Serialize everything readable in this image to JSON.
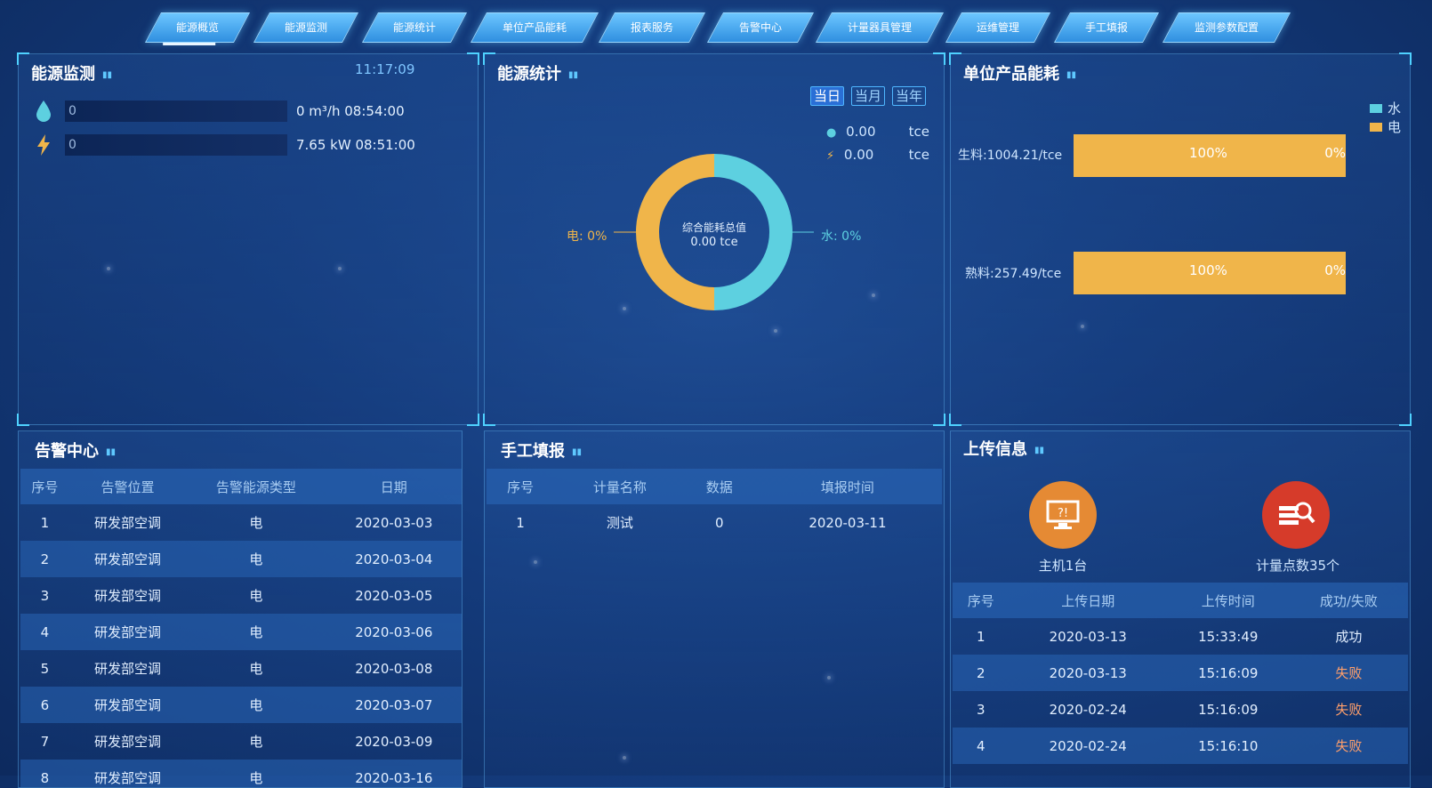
{
  "nav": [
    "能源概览",
    "能源监测",
    "能源统计",
    "单位产品能耗",
    "报表服务",
    "告警中心",
    "计量器具管理",
    "运维管理",
    "手工填报",
    "监测参数配置"
  ],
  "monitor": {
    "title": "能源监测",
    "time": "11:17:09",
    "rows": [
      {
        "icon": "water-drop-icon",
        "bar": "0",
        "text": "0 m³/h  08:54:00"
      },
      {
        "icon": "lightning-icon",
        "bar": "0",
        "text": "7.65 kW  08:51:00"
      }
    ]
  },
  "stats": {
    "title": "能源统计",
    "tabs": [
      "当日",
      "当月",
      "当年"
    ],
    "water_value": "0.00",
    "elec_value": "0.00",
    "unit": "tce",
    "center_label": "综合能耗总值",
    "center_value": "0.00 tce",
    "label_left": "电: 0%",
    "label_right": "水: 0%"
  },
  "chart_data": {
    "type": "pie",
    "categories": [
      "水",
      "电"
    ],
    "values": [
      50,
      50
    ]
  },
  "unit_energy": {
    "title": "单位产品能耗",
    "legend": [
      "水",
      "电"
    ],
    "legend_colors": [
      "#5dd0e0",
      "#f0b54a"
    ],
    "rows": [
      {
        "label": "生料:1004.21/tce",
        "left": "100%",
        "right": "0%"
      },
      {
        "label": "熟料:257.49/tce",
        "left": "100%",
        "right": "0%"
      }
    ]
  },
  "alarm": {
    "title": "告警中心",
    "headers": [
      "序号",
      "告警位置",
      "告警能源类型",
      "日期"
    ],
    "rows": [
      [
        "1",
        "研发部空调",
        "电",
        "2020-03-03"
      ],
      [
        "2",
        "研发部空调",
        "电",
        "2020-03-04"
      ],
      [
        "3",
        "研发部空调",
        "电",
        "2020-03-05"
      ],
      [
        "4",
        "研发部空调",
        "电",
        "2020-03-06"
      ],
      [
        "5",
        "研发部空调",
        "电",
        "2020-03-08"
      ],
      [
        "6",
        "研发部空调",
        "电",
        "2020-03-07"
      ],
      [
        "7",
        "研发部空调",
        "电",
        "2020-03-09"
      ],
      [
        "8",
        "研发部空调",
        "电",
        "2020-03-16"
      ]
    ]
  },
  "manual": {
    "title": "手工填报",
    "headers": [
      "序号",
      "计量名称",
      "数据",
      "填报时间"
    ],
    "rows": [
      [
        "1",
        "测试",
        "0",
        "2020-03-11"
      ]
    ]
  },
  "upload": {
    "title": "上传信息",
    "host_label": "主机1台",
    "points_label": "计量点数35个",
    "headers": [
      "序号",
      "上传日期",
      "上传时间",
      "成功/失败"
    ],
    "rows": [
      [
        "1",
        "2020-03-13",
        "15:33:49",
        "成功"
      ],
      [
        "2",
        "2020-03-13",
        "15:16:09",
        "失败"
      ],
      [
        "3",
        "2020-02-24",
        "15:16:09",
        "失败"
      ],
      [
        "4",
        "2020-02-24",
        "15:16:10",
        "失败"
      ]
    ]
  },
  "colors": {
    "water": "#5dd0e0",
    "elec": "#f0b54a",
    "accent": "#4fd2ff"
  }
}
